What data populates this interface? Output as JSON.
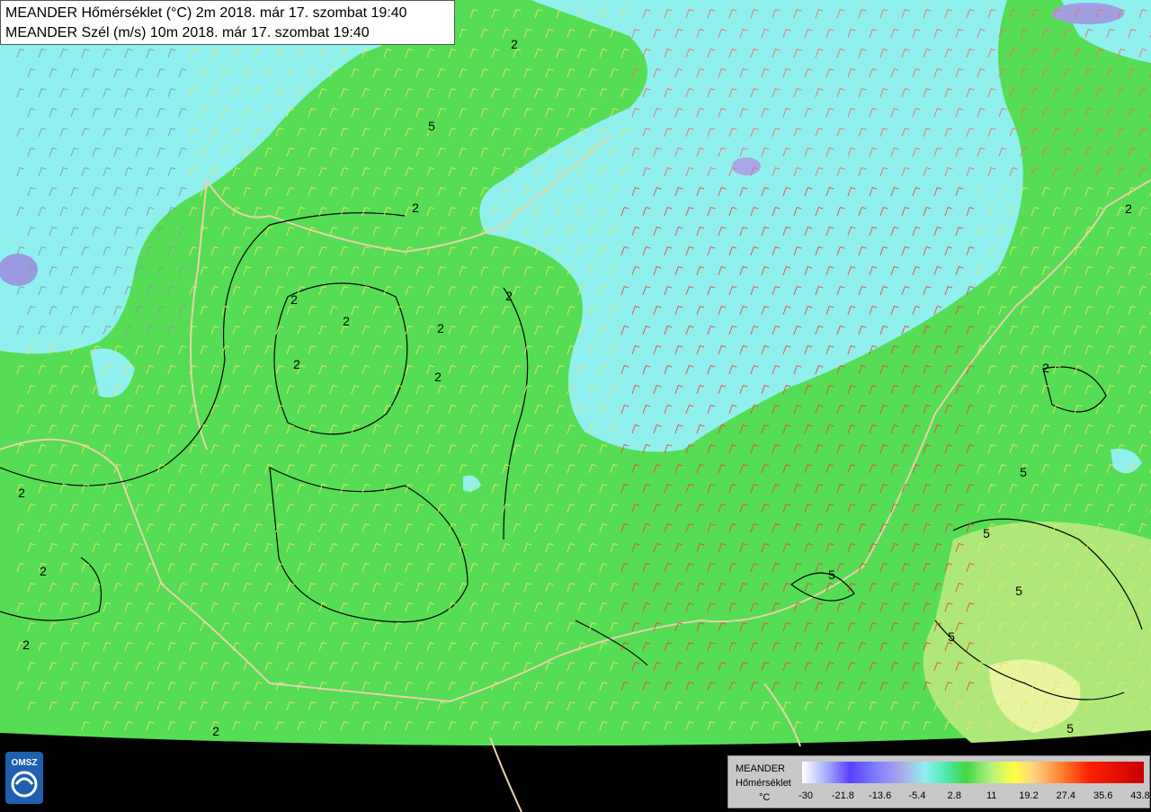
{
  "header": {
    "line1": "MEANDER Hőmérséklet (°C) 2m 2018. már 17. szombat 19:40",
    "line2": "MEANDER Szél (m/s) 10m 2018. már 17. szombat 19:40"
  },
  "logo": {
    "text": "OMSZ",
    "icon": "omsz-logo-icon"
  },
  "legend": {
    "title_line1": "MEANDER",
    "title_line2": "Hőmérséklet",
    "unit": "°C",
    "ticks": [
      "-30",
      "-21.8",
      "-13.6",
      "-5.4",
      "2.8",
      "11",
      "19.2",
      "27.4",
      "35.6",
      "43.8"
    ]
  },
  "map": {
    "contour_labels": [
      "2",
      "2",
      "2",
      "2",
      "2",
      "2",
      "2",
      "2",
      "2",
      "2",
      "2",
      "2",
      "2",
      "2",
      "5",
      "5",
      "5",
      "5",
      "5",
      "5",
      "5"
    ],
    "colors": {
      "cold": "#8ff0ee",
      "mild": "#55dd55",
      "warm": "#c8f09a",
      "background": "#000000",
      "border": "#e8d3a8",
      "contour": "#000000"
    }
  }
}
